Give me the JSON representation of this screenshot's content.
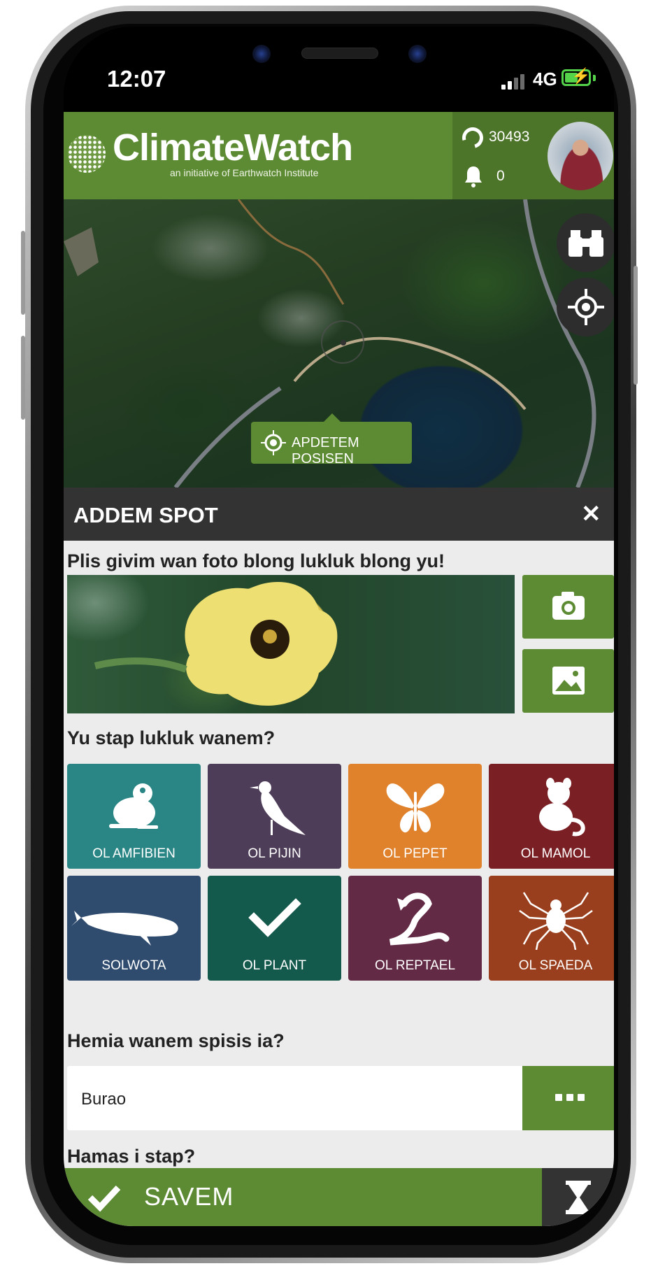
{
  "status_bar": {
    "time": "12:07",
    "network": "4G"
  },
  "header": {
    "brand": "ClimateWatch",
    "tagline": "an initiative of Earthwatch Institute",
    "points": "30493",
    "notifications": "0",
    "accent_color": "#5d8b33"
  },
  "map": {
    "update_location_label": "APDETEM POSISEN"
  },
  "panel": {
    "title": "ADDEM SPOT",
    "close_icon": "close-icon",
    "photo_prompt": "Plis givim wan foto blong lukluk blong yu!",
    "category_prompt": "Yu stap lukluk wanem?",
    "categories": [
      {
        "label": "OL AMFIBIEN",
        "icon": "frog-icon",
        "color": "#2a8585",
        "selected": false
      },
      {
        "label": "OL PIJIN",
        "icon": "magpie-icon",
        "color": "#4e3d58",
        "selected": false
      },
      {
        "label": "OL PEPET",
        "icon": "butterfly-icon",
        "color": "#e0822b",
        "selected": false
      },
      {
        "label": "OL MAMOL",
        "icon": "possum-icon",
        "color": "#7a1f24",
        "selected": false
      },
      {
        "label": "SOLWOTA",
        "icon": "whale-icon",
        "color": "#2f4b6e",
        "selected": false
      },
      {
        "label": "OL PLANT",
        "icon": "check-icon",
        "color": "#145a4c",
        "selected": true
      },
      {
        "label": "OL REPTAEL",
        "icon": "lizard-icon",
        "color": "#632a45",
        "selected": false
      },
      {
        "label": "OL SPAEDA",
        "icon": "spider-icon",
        "color": "#9a3f1e",
        "selected": false
      }
    ],
    "species_prompt": "Hemia wanem spisis ia?",
    "species_value": "Burao",
    "count_prompt": "Hamas i stap?"
  },
  "footer": {
    "save_label": "SAVEM"
  }
}
